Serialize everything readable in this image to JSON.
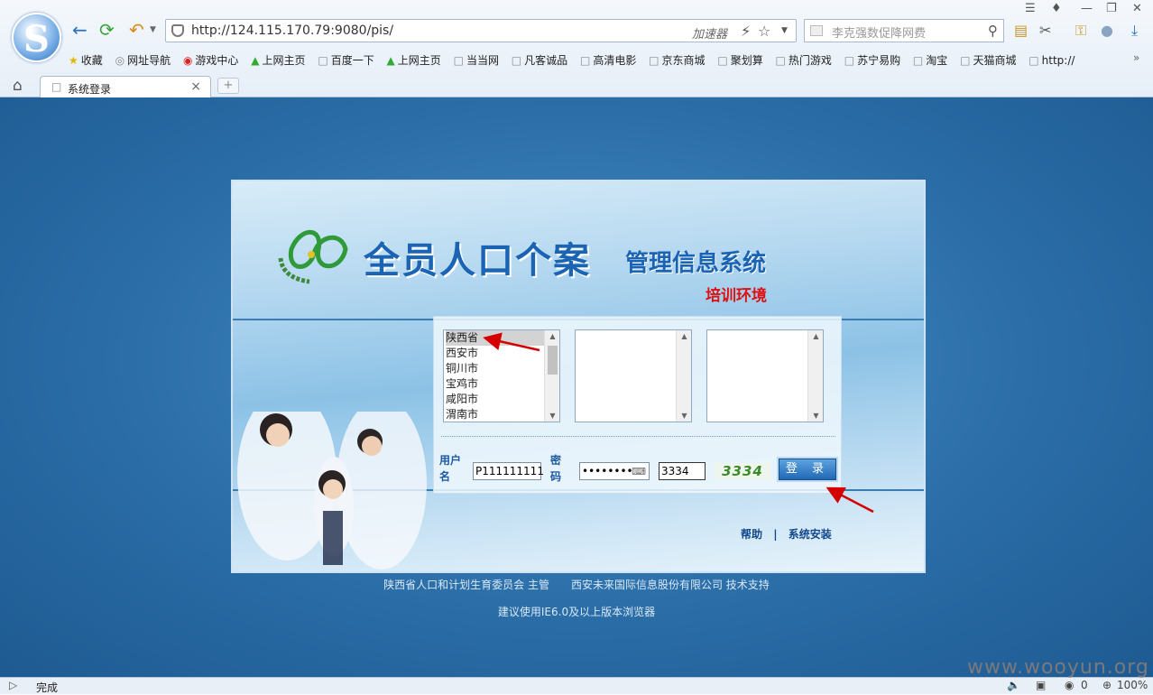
{
  "browser": {
    "url": "http://124.115.170.79:9080/pis/",
    "accelerator": "加速器",
    "search_placeholder": "李克强数促降网费",
    "bookmarks": [
      "收藏",
      "网址导航",
      "游戏中心",
      "上网主页",
      "百度一下",
      "上网主页",
      "当当网",
      "凡客诚品",
      "高清电影",
      "京东商城",
      "聚划算",
      "热门游戏",
      "苏宁易购",
      "淘宝",
      "天猫商城",
      "http://"
    ],
    "tab_title": "系统登录",
    "status_text": "完成",
    "status_count": "0",
    "zoom": "100%"
  },
  "page": {
    "title_main": "全员人口个案",
    "title_sub": "管理信息系统",
    "title_env": "培训环境",
    "province_list": [
      "陕西省",
      "西安市",
      "铜川市",
      "宝鸡市",
      "咸阳市",
      "渭南市"
    ],
    "province_selected": "陕西省",
    "username_label": "用户名",
    "username_value": "P111111111",
    "password_label": "密码",
    "password_value": "••••••••",
    "captcha_input": "3334",
    "captcha_image_text": "3334",
    "login_button": "登 录",
    "help_link": "帮助",
    "link_separator": "|",
    "install_link": "系统安装",
    "footer_line1": "陕西省人口和计划生育委员会 主管　　西安未来国际信息股份有限公司 技术支持",
    "footer_line2": "建议使用IE6.0及以上版本浏览器"
  },
  "watermark": "www.wooyun.org",
  "colors": {
    "arrow": "#d40000",
    "title": "#1b64b4",
    "env": "#d11111"
  }
}
